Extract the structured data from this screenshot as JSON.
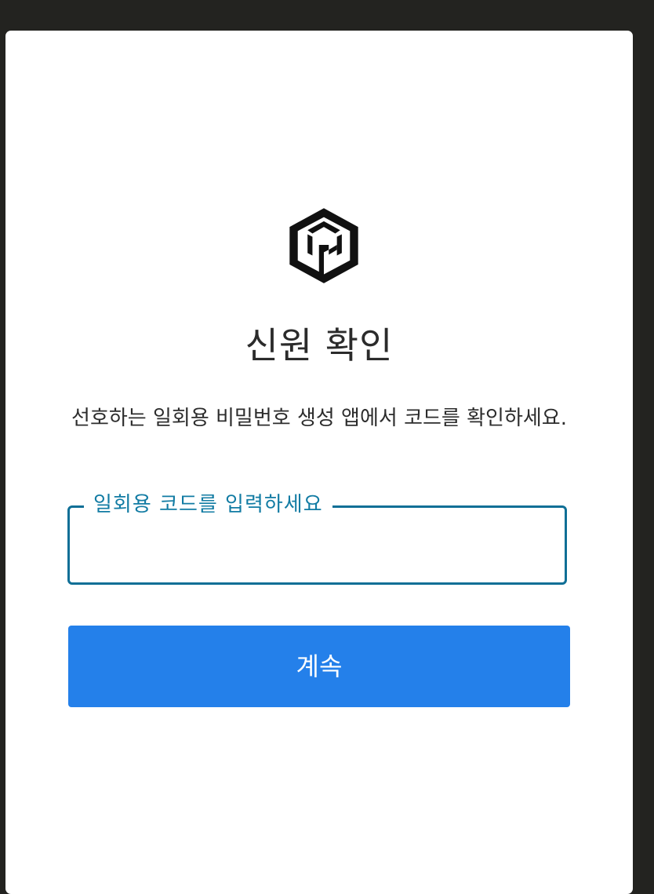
{
  "logo": {
    "icon": "cube-logo-icon"
  },
  "title": "신원 확인",
  "description": "선호하는 일회용 비밀번호 생성 앱에서 코드를 확인하세요.",
  "otp_field": {
    "label": "일회용 코드를 입력하세요",
    "value": ""
  },
  "continue_button": {
    "label": "계속"
  },
  "colors": {
    "background": "#232320",
    "card": "#ffffff",
    "field_accent": "#0f6f96",
    "button": "#2480ea"
  }
}
